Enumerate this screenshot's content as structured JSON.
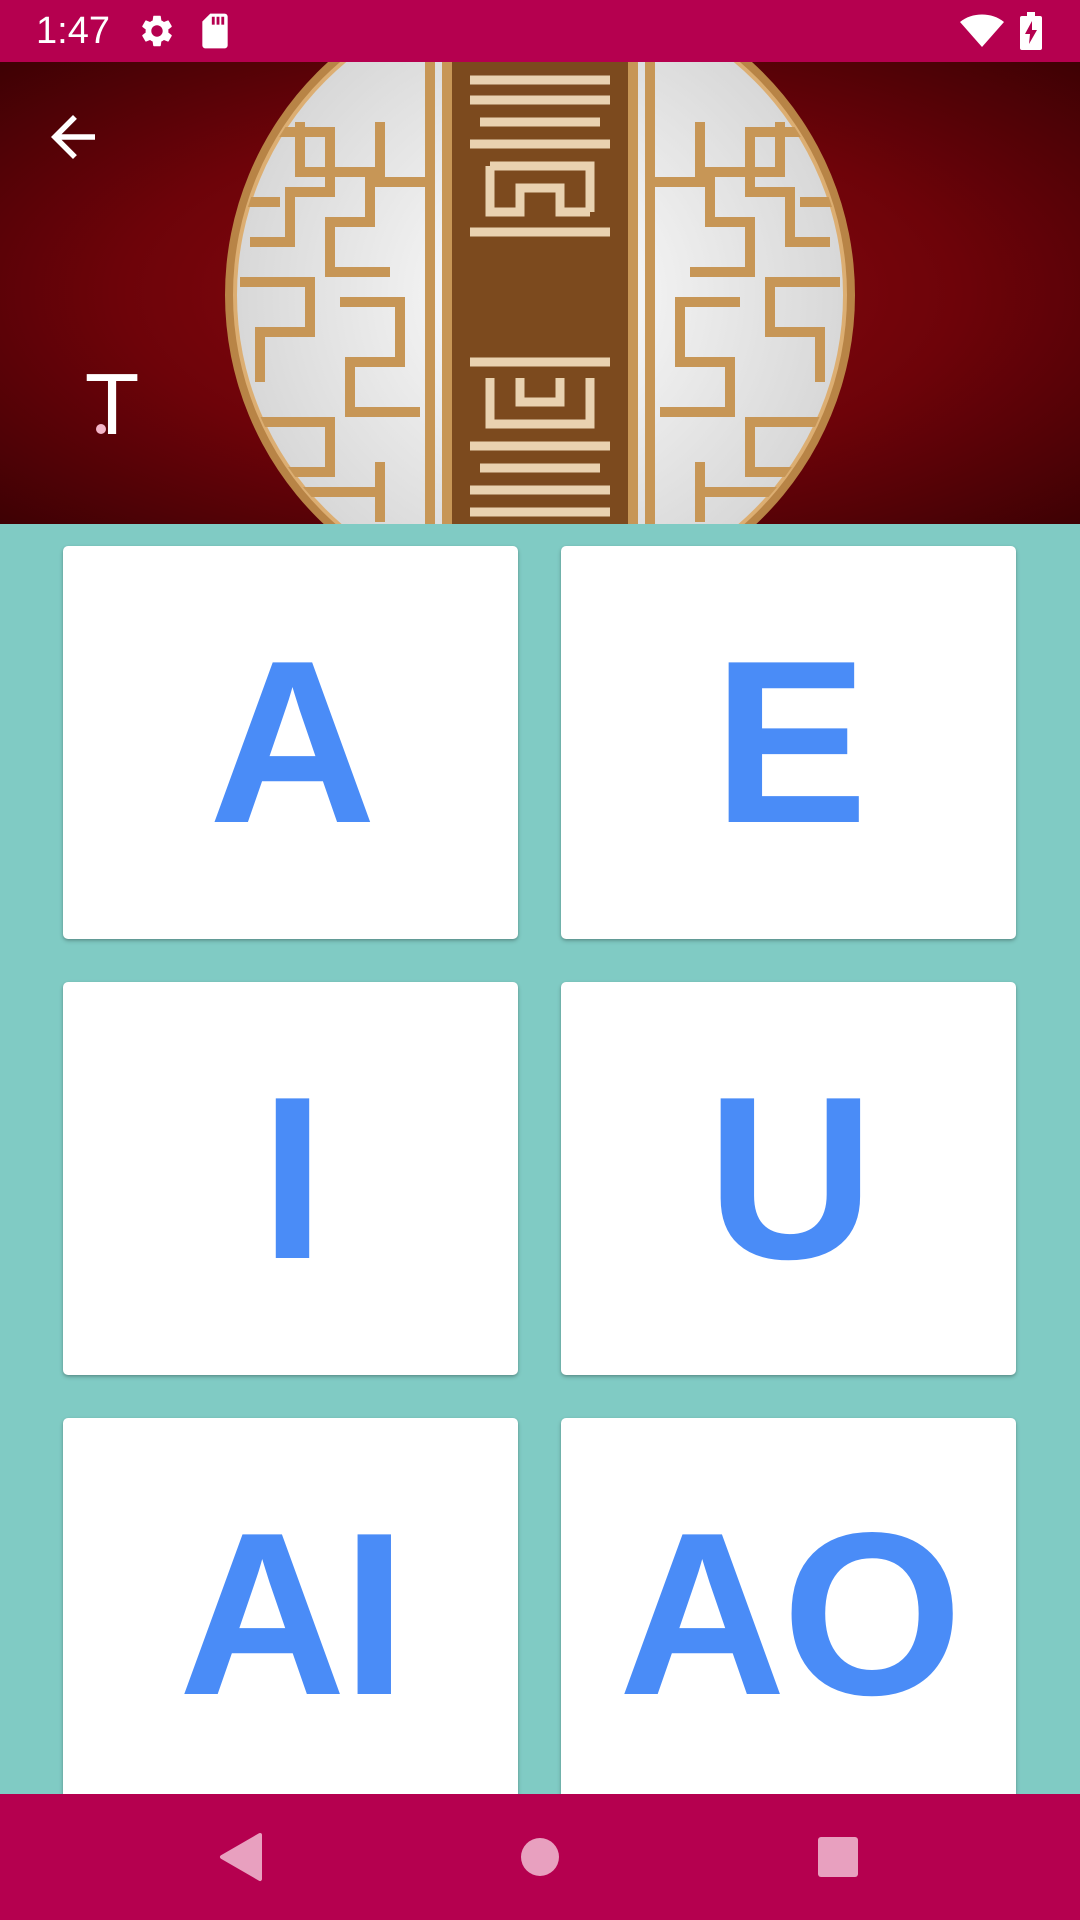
{
  "status_bar": {
    "time": "1:47",
    "icons": [
      "settings-icon",
      "sd-card-icon",
      "wifi-icon",
      "battery-charging-icon"
    ]
  },
  "header": {
    "back_icon": "arrow-back-icon",
    "glyph": "T",
    "art": "chinese-lattice-window"
  },
  "grid": {
    "cards": [
      {
        "label": "A"
      },
      {
        "label": "E"
      },
      {
        "label": "I"
      },
      {
        "label": "U"
      },
      {
        "label": "AI"
      },
      {
        "label": "AO"
      }
    ]
  },
  "nav_bar": {
    "icons": [
      "nav-back-icon",
      "nav-home-icon",
      "nav-recents-icon"
    ]
  },
  "colors": {
    "status_bar": "#b5004f",
    "background": "#80cbc4",
    "card": "#ffffff",
    "letter": "#4a8cf7",
    "header_red": "#6d0309",
    "lattice_gold": "#c79656"
  }
}
